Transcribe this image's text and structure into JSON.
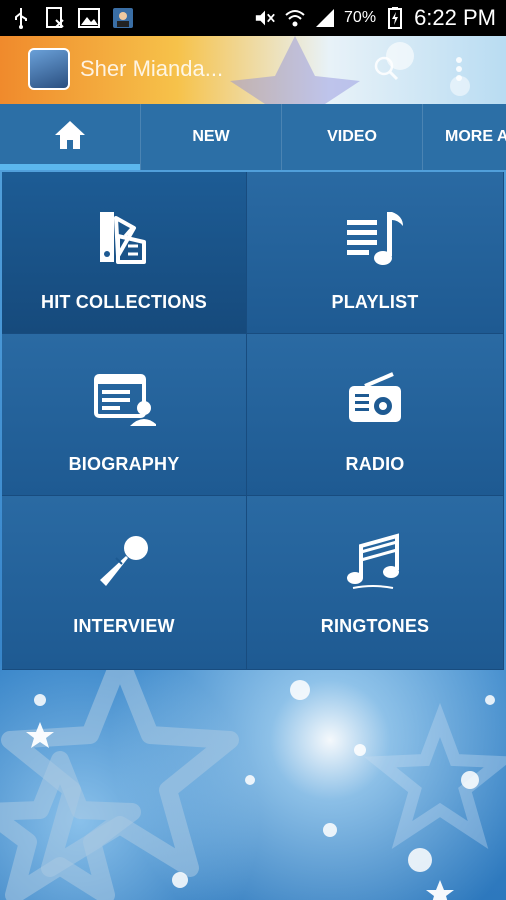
{
  "status_bar": {
    "battery_percent": "70%",
    "time": "6:22 PM"
  },
  "action_bar": {
    "title": "Sher Mianda..."
  },
  "tabs": [
    {
      "label": "",
      "icon": "home-icon",
      "selected": true
    },
    {
      "label": "NEW"
    },
    {
      "label": "VIDEO"
    },
    {
      "label": "MORE A"
    }
  ],
  "menu": [
    {
      "label": "HIT COLLECTIONS",
      "icon": "palette-icon"
    },
    {
      "label": "PLAYLIST",
      "icon": "playlist-icon"
    },
    {
      "label": "BIOGRAPHY",
      "icon": "biography-icon"
    },
    {
      "label": "RADIO",
      "icon": "radio-icon"
    },
    {
      "label": "INTERVIEW",
      "icon": "microphone-icon"
    },
    {
      "label": "RINGTONES",
      "icon": "music-notes-icon"
    }
  ],
  "colors": {
    "tab_indicator": "#5bb7ee",
    "tab_bar": "#2c6fa6",
    "grid_cell": "#1e5a92"
  }
}
